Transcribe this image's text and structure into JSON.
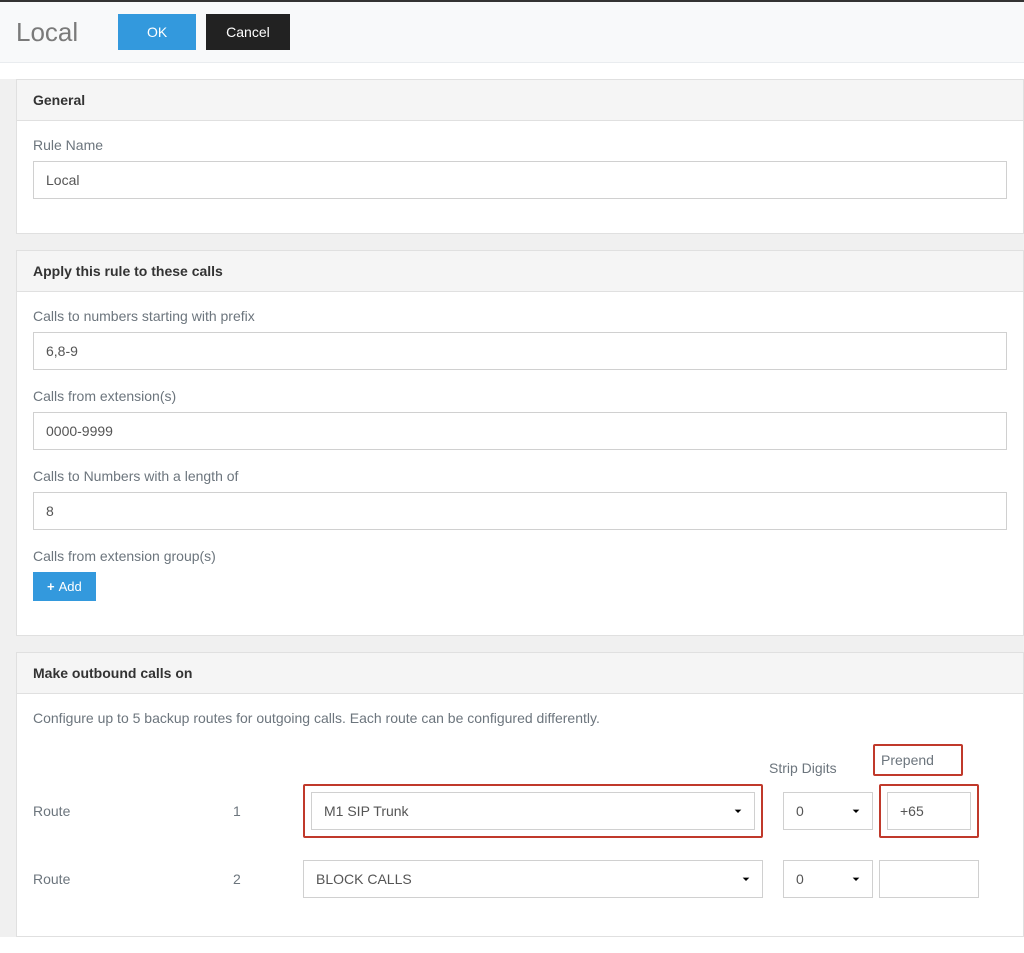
{
  "header": {
    "title": "Local",
    "ok_label": "OK",
    "cancel_label": "Cancel"
  },
  "panels": {
    "general": {
      "heading": "General",
      "rule_name_label": "Rule Name",
      "rule_name_value": "Local"
    },
    "apply": {
      "heading": "Apply this rule to these calls",
      "prefix_label": "Calls to numbers starting with prefix",
      "prefix_value": "6,8-9",
      "from_ext_label": "Calls from extension(s)",
      "from_ext_value": "0000-9999",
      "length_label": "Calls to Numbers with a length of",
      "length_value": "8",
      "from_group_label": "Calls from extension group(s)",
      "add_label": "Add"
    },
    "outbound": {
      "heading": "Make outbound calls on",
      "description": "Configure up to 5 backup routes for outgoing calls. Each route can be configured differently.",
      "route_label": "Route",
      "strip_label": "Strip Digits",
      "prepend_label": "Prepend",
      "routes": [
        {
          "num": "1",
          "trunk": "M1 SIP Trunk",
          "strip": "0",
          "prepend": "+65"
        },
        {
          "num": "2",
          "trunk": "BLOCK CALLS",
          "strip": "0",
          "prepend": ""
        }
      ]
    }
  }
}
